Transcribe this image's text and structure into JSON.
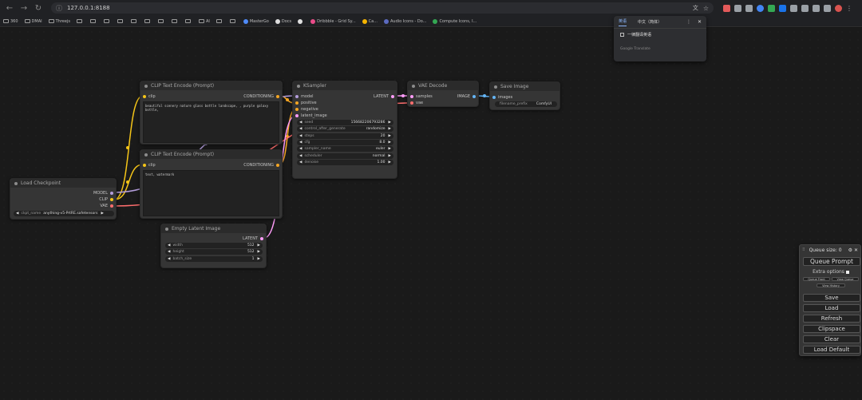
{
  "browser": {
    "url": "127.0.0.1:8188",
    "bookmarks": [
      {
        "label": "360",
        "type": "folder"
      },
      {
        "label": "DMAI",
        "type": "folder"
      },
      {
        "label": "Threejs",
        "type": "folder"
      },
      {
        "label": "",
        "type": "folder"
      },
      {
        "label": "",
        "type": "folder"
      },
      {
        "label": "",
        "type": "folder"
      },
      {
        "label": "",
        "type": "folder"
      },
      {
        "label": "",
        "type": "folder"
      },
      {
        "label": "",
        "type": "folder"
      },
      {
        "label": "",
        "type": "folder"
      },
      {
        "label": "",
        "type": "folder"
      },
      {
        "label": "",
        "type": "folder"
      },
      {
        "label": "AI",
        "type": "folder"
      },
      {
        "label": "",
        "type": "folder"
      },
      {
        "label": "",
        "type": "folder"
      },
      {
        "label": "MasterGo",
        "type": "site"
      },
      {
        "label": "Docs",
        "type": "site"
      },
      {
        "label": "",
        "type": "site"
      },
      {
        "label": "Dribbble - Grid Sy...",
        "type": "site"
      },
      {
        "label": "Ca...",
        "type": "site"
      },
      {
        "label": "Audio Icons - Do...",
        "type": "site"
      },
      {
        "label": "Compute Icons, I...",
        "type": "site"
      }
    ]
  },
  "translate_popup": {
    "tab_source": "英语",
    "tab_target": "中文（简体）",
    "checkbox_label": "一律翻译英语",
    "brand": "Google Translate"
  },
  "nodes": {
    "clip1": {
      "title": "CLIP Text Encode (Prompt)",
      "input": "clip",
      "output": "CONDITIONING",
      "text": "beautiful scenery nature glass bottle landscape, , purple galaxy bottle,"
    },
    "clip2": {
      "title": "CLIP Text Encode (Prompt)",
      "input": "clip",
      "output": "CONDITIONING",
      "text": "text, watermark"
    },
    "load": {
      "title": "Load Checkpoint",
      "outputs": [
        "MODEL",
        "CLIP",
        "VAE"
      ],
      "widget_label": "ckpt_name",
      "widget_value": "anything-v5-PrtRE.safetensors"
    },
    "ksampler": {
      "title": "KSampler",
      "inputs": [
        "model",
        "positive",
        "negative",
        "latent_image"
      ],
      "output": "LATENT",
      "widgets": [
        {
          "label": "seed",
          "value": "156682206793286"
        },
        {
          "label": "control_after_generate",
          "value": "randomize"
        },
        {
          "label": "steps",
          "value": "20"
        },
        {
          "label": "cfg",
          "value": "8.0"
        },
        {
          "label": "sampler_name",
          "value": "euler"
        },
        {
          "label": "scheduler",
          "value": "normal"
        },
        {
          "label": "denoise",
          "value": "1.00"
        }
      ]
    },
    "vae": {
      "title": "VAE Decode",
      "inputs": [
        "samples",
        "vae"
      ],
      "output": "IMAGE"
    },
    "save": {
      "title": "Save Image",
      "input": "images",
      "widget_label": "filename_prefix",
      "widget_value": "ComfyUI"
    },
    "latent": {
      "title": "Empty Latent Image",
      "output": "LATENT",
      "widgets": [
        {
          "label": "width",
          "value": "512"
        },
        {
          "label": "height",
          "value": "512"
        },
        {
          "label": "batch_size",
          "value": "1"
        }
      ]
    }
  },
  "queue": {
    "size_label": "Queue size: 0",
    "queue_prompt": "Queue Prompt",
    "extra_options": "Extra options",
    "queue_front": "Queue Front",
    "view_queue": "View Queue",
    "view_history": "View History",
    "save": "Save",
    "load": "Load",
    "refresh": "Refresh",
    "clipspace": "Clipspace",
    "clear": "Clear",
    "load_default": "Load Default"
  },
  "colors": {
    "clip": "#f5c518",
    "conditioning": "#f5a623",
    "model": "#b39ddb",
    "vae": "#ff6e6e",
    "latent": "#ff9cf9",
    "image": "#64b5f6"
  }
}
